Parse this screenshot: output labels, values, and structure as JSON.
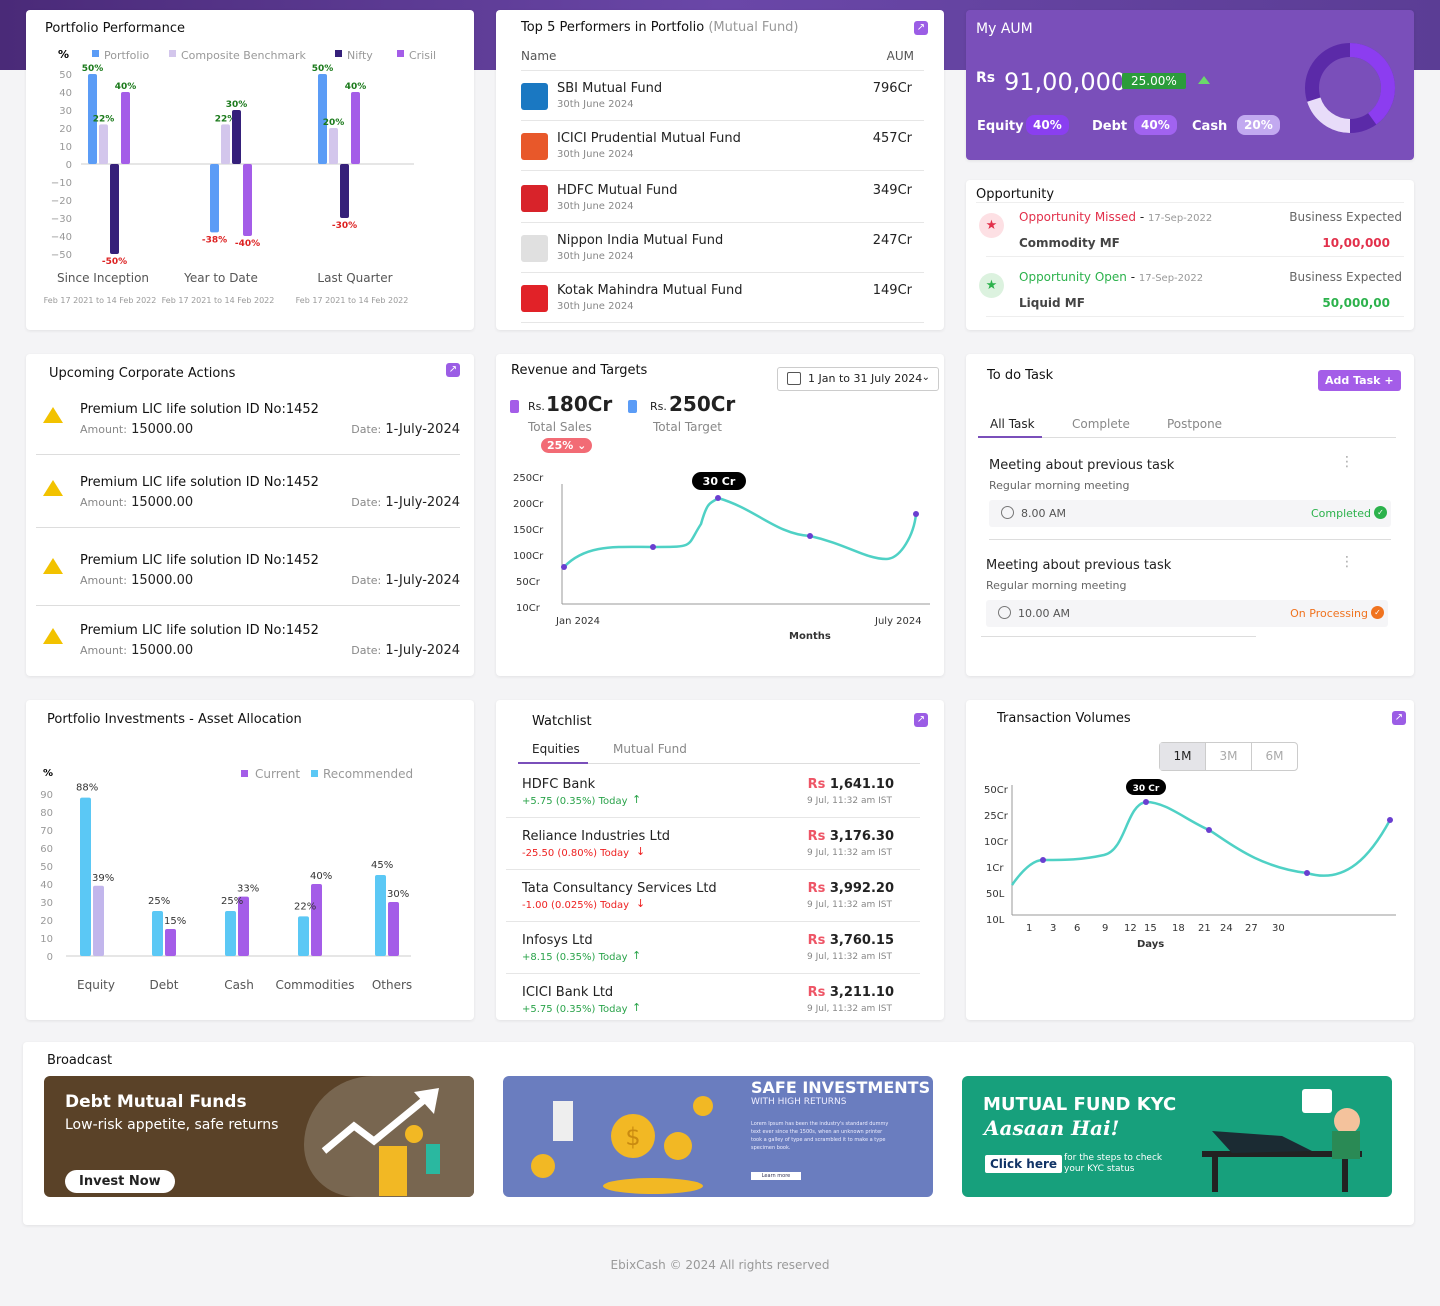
{
  "perf": {
    "title": "Portfolio Performance",
    "pct": "%",
    "legend": [
      "Portfolio",
      "Composite Benchmark",
      "Nifty",
      "Crisil"
    ],
    "colors": [
      "#5b9cf6",
      "#d3c6ec",
      "#35207a",
      "#a45de8"
    ],
    "yticks": [
      "50",
      "40",
      "30",
      "20",
      "10",
      "0",
      "−10",
      "−20",
      "−30",
      "−40",
      "−50"
    ],
    "groups": [
      {
        "label": "Since Inception",
        "range": "Feb 17 2021 to 14 Feb 2022",
        "values": [
          50,
          22,
          -50,
          40
        ],
        "vlabels": [
          "50%",
          "22%",
          "-50%",
          "40%"
        ]
      },
      {
        "label": "Year to Date",
        "range": "Feb 17 2021 to 14 Feb 2022",
        "values": [
          -38,
          22,
          30,
          -40
        ],
        "vlabels": [
          "-38%",
          "22%",
          "30%",
          "-40%"
        ]
      },
      {
        "label": "Last Quarter",
        "range": "Feb 17 2021 to 14 Feb 2022",
        "values": [
          50,
          20,
          -30,
          40
        ],
        "vlabels": [
          "50%",
          "20%",
          "-30%",
          "40%"
        ]
      }
    ]
  },
  "top5": {
    "title": "Top 5 Performers in Portfolio",
    "subtitle": "(Mutual Fund)",
    "col_name": "Name",
    "col_aum": "AUM",
    "rows": [
      {
        "name": "SBI Mutual Fund",
        "date": "30th June 2024",
        "aum": "796Cr",
        "color": "#1a78c2"
      },
      {
        "name": "ICICI Prudential Mutual Fund",
        "date": "30th June 2024",
        "aum": "457Cr",
        "color": "#e8582a"
      },
      {
        "name": "HDFC Mutual Fund",
        "date": "30th June 2024",
        "aum": "349Cr",
        "color": "#d8232a"
      },
      {
        "name": "Nippon India Mutual Fund",
        "date": "30th June 2024",
        "aum": "247Cr",
        "color": "#e0e0e0"
      },
      {
        "name": "Kotak Mahindra  Mutual Fund",
        "date": "30th June 2024",
        "aum": "149Cr",
        "color": "#e12228"
      }
    ]
  },
  "aum": {
    "title": "My AUM",
    "rs": "Rs",
    "value": "91,00,000",
    "change": "25.00%",
    "equity_label": "Equity",
    "equity": "40%",
    "debt_label": "Debt",
    "debt": "40%",
    "cash_label": "Cash",
    "cash": "20%"
  },
  "opp": {
    "title": "Opportunity",
    "items": [
      {
        "status": "Opportunity Missed",
        "date": "17-Sep-2022",
        "be": "Business Expected",
        "name": "Commodity MF",
        "amount": "10,00,000",
        "color": "#e2304b"
      },
      {
        "status": "Opportunity Open",
        "date": "17-Sep-2022",
        "be": "Business Expected",
        "name": "Liquid MF",
        "amount": "50,000,00",
        "color": "#2cb24c"
      }
    ]
  },
  "corp": {
    "title": "Upcoming Corporate Actions",
    "items": [
      {
        "name": "Premium LIC life solution ID No:1452",
        "amount_label": "Amount:",
        "amount": "15000.00",
        "date_label": "Date:",
        "date": "1-July-2024"
      },
      {
        "name": "Premium LIC life solution ID No:1452",
        "amount_label": "Amount:",
        "amount": "15000.00",
        "date_label": "Date:",
        "date": "1-July-2024"
      },
      {
        "name": "Premium LIC life solution ID No:1452",
        "amount_label": "Amount:",
        "amount": "15000.00",
        "date_label": "Date:",
        "date": "1-July-2024"
      },
      {
        "name": "Premium LIC life solution ID No:1452",
        "amount_label": "Amount:",
        "amount": "15000.00",
        "date_label": "Date:",
        "date": "1-July-2024"
      }
    ]
  },
  "rev": {
    "title": "Revenue and Targets",
    "date_range": "1 Jan to 31 July 2024",
    "rs": "Rs.",
    "sales": "180Cr",
    "sales_label": "Total Sales",
    "sales_pct": "25%",
    "target": "250Cr",
    "target_label": "Total Target",
    "tooltip": "30 Cr",
    "xlabel": "Months"
  },
  "todo": {
    "title": "To do Task",
    "add": "Add Task",
    "tabs": [
      "All Task",
      "Complete",
      "Postpone"
    ],
    "tasks": [
      {
        "title": "Meeting about previous task",
        "sub": "Regular morning meeting",
        "time": "8.00 AM",
        "status": "Completed",
        "color": "#2cb24c"
      },
      {
        "title": "Meeting about previous task",
        "sub": "Regular morning meeting",
        "time": "10.00 AM",
        "status": "On Processing",
        "color": "#f0731f"
      }
    ]
  },
  "alloc": {
    "title": "Portfolio Investments - Asset Allocation",
    "pct": "%",
    "legend": [
      "Current",
      "Recommended"
    ],
    "colors": [
      "#a45de8",
      "#5bc8f5"
    ]
  },
  "watch": {
    "title": "Watchlist",
    "tabs": [
      "Equities",
      "Mutual Fund"
    ],
    "rows": [
      {
        "name": "HDFC Bank",
        "change": "+5.75 (0.35%) Today",
        "up": true,
        "rs": "Rs",
        "price": "1,641.10",
        "time": "9 Jul, 11:32 am IST"
      },
      {
        "name": "Reliance Industries Ltd",
        "change": "-25.50 (0.80%) Today",
        "up": false,
        "rs": "Rs",
        "price": "3,176.30",
        "time": "9 Jul, 11:32 am IST"
      },
      {
        "name": "Tata Consultancy Services Ltd",
        "change": "-1.00 (0.025%) Today",
        "up": false,
        "rs": "Rs",
        "price": "3,992.20",
        "time": "9 Jul, 11:32 am IST"
      },
      {
        "name": "Infosys Ltd",
        "change": "+8.15 (0.35%) Today",
        "up": true,
        "rs": "Rs",
        "price": "3,760.15",
        "time": "9 Jul, 11:32 am IST"
      },
      {
        "name": "ICICI Bank Ltd",
        "change": "+5.75 (0.35%) Today",
        "up": true,
        "rs": "Rs",
        "price": "3,211.10",
        "time": "9 Jul, 11:32 am IST"
      }
    ]
  },
  "tv": {
    "title": "Transaction Volumes",
    "ranges": [
      "1M",
      "3M",
      "6M"
    ],
    "tooltip": "30 Cr",
    "xlabel": "Days"
  },
  "broadcast": {
    "title": "Broadcast",
    "b1": {
      "title": "Debt Mutual Funds",
      "sub": "Low-risk appetite, safe returns",
      "cta": "Invest Now"
    },
    "b2": {
      "title": "SAFE INVESTMENTS",
      "sub": "WITH HIGH RETURNS",
      "body": "Lorem Ipsum has been the industry's standard dummy text ever since the 1500s, when an unknown printer took a galley of type and scrambled it to make a type specimen book.",
      "cta": "Learn more"
    },
    "b3": {
      "title": "MUTUAL FUND KYC",
      "sub": "Aasaan Hai!",
      "cta": "Click here",
      "note": "for the steps to check your KYC status"
    }
  },
  "footer": "EbixCash © 2024 All rights reserved",
  "chart_data": [
    {
      "type": "bar",
      "title": "Portfolio Performance",
      "categories": [
        "Since Inception",
        "Year to Date",
        "Last Quarter"
      ],
      "ylim": [
        -50,
        50
      ],
      "series": [
        {
          "name": "Portfolio",
          "values": [
            50,
            -38,
            50
          ]
        },
        {
          "name": "Composite Benchmark",
          "values": [
            22,
            22,
            20
          ]
        },
        {
          "name": "Nifty",
          "values": [
            -50,
            30,
            -30
          ]
        },
        {
          "name": "Crisil",
          "values": [
            40,
            -40,
            40
          ]
        }
      ]
    },
    {
      "type": "line",
      "title": "Revenue and Targets",
      "xlabel": "Months",
      "x_ticks": [
        "Jan 2024",
        "July 2024"
      ],
      "y_ticks": [
        "250Cr",
        "200Cr",
        "150Cr",
        "100Cr",
        "50Cr",
        "10Cr"
      ],
      "points": [
        [
          0,
          60
        ],
        [
          1,
          110
        ],
        [
          1.7,
          200
        ],
        [
          2.8,
          130
        ],
        [
          4,
          200
        ]
      ]
    },
    {
      "type": "bar",
      "title": "Portfolio Investments - Asset Allocation",
      "categories": [
        "Equity",
        "Debt",
        "Cash",
        "Commodities",
        "Others"
      ],
      "ylim": [
        0,
        90
      ],
      "yticks": [
        "0",
        "10",
        "20",
        "30",
        "40",
        "50",
        "60",
        "70",
        "80",
        "90"
      ],
      "series": [
        {
          "name": "Recommended",
          "values": [
            88,
            25,
            25,
            22,
            45
          ]
        },
        {
          "name": "Current",
          "values": [
            39,
            15,
            33,
            40,
            30
          ]
        }
      ]
    },
    {
      "type": "line",
      "title": "Transaction Volumes",
      "xlabel": "Days",
      "x_ticks": [
        "1",
        "3",
        "6",
        "9",
        "12",
        "15",
        "18",
        "21",
        "24",
        "27",
        "30"
      ],
      "y_ticks": [
        "50Cr",
        "25Cr",
        "10Cr",
        "1Cr",
        "50L",
        "10L"
      ]
    }
  ]
}
